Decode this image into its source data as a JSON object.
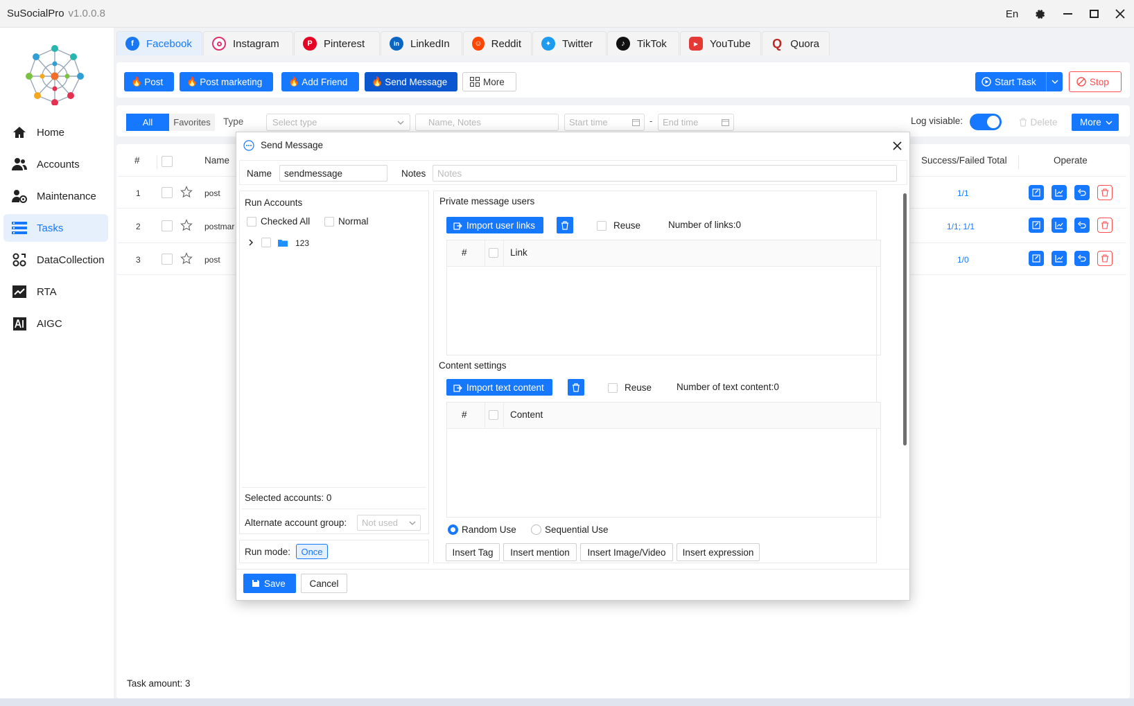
{
  "app": {
    "name": "SuSocialPro",
    "version": "v1.0.0.8",
    "lang": "En"
  },
  "sidebar": {
    "items": [
      {
        "label": "Home",
        "icon": "home-icon"
      },
      {
        "label": "Accounts",
        "icon": "users-icon"
      },
      {
        "label": "Maintenance",
        "icon": "user-gear-icon"
      },
      {
        "label": "Tasks",
        "icon": "tasks-icon",
        "active": true
      },
      {
        "label": "DataCollection",
        "icon": "data-collection-icon"
      },
      {
        "label": "RTA",
        "icon": "chart-line-icon"
      },
      {
        "label": "AIGC",
        "icon": "ai-icon"
      }
    ]
  },
  "tabs": [
    {
      "label": "Facebook",
      "color": "#1877f2"
    },
    {
      "label": "Instagram",
      "color": "#e1306c"
    },
    {
      "label": "Pinterest",
      "color": "#e60023"
    },
    {
      "label": "LinkedIn",
      "color": "#0a66c2"
    },
    {
      "label": "Reddit",
      "color": "#ff4500"
    },
    {
      "label": "Twitter",
      "color": "#1d9bf0"
    },
    {
      "label": "TikTok",
      "color": "#111111"
    },
    {
      "label": "YouTube",
      "color": "#e53935"
    },
    {
      "label": "Quora",
      "color": "#b92b27"
    }
  ],
  "actions": {
    "post": "Post",
    "post_marketing": "Post marketing",
    "add_friend": "Add Friend",
    "send_message": "Send Message",
    "more": "More",
    "start_task": "Start Task",
    "stop": "Stop"
  },
  "filter": {
    "all": "All",
    "favorites": "Favorites",
    "type_label": "Type",
    "type_placeholder": "Select type",
    "search_placeholder": "Name, Notes",
    "start_placeholder": "Start time",
    "dash": "-",
    "end_placeholder": "End time",
    "log_visible": "Log visiable:",
    "delete": "Delete",
    "more": "More"
  },
  "table": {
    "headers": {
      "index": "#",
      "name": "Name",
      "success": "Success/Failed Total",
      "operate": "Operate"
    },
    "rows": [
      {
        "index": "1",
        "name": "post",
        "success": "1/1"
      },
      {
        "index": "2",
        "name": "postmar",
        "success": "1/1; 1/1"
      },
      {
        "index": "3",
        "name": "post",
        "success": "1/0"
      }
    ],
    "task_amount": "Task amount: 3"
  },
  "modal": {
    "title": "Send Message",
    "name_label": "Name",
    "name_value": "sendmessage",
    "notes_label": "Notes",
    "notes_placeholder": "Notes",
    "run_accounts": "Run Accounts",
    "checked_all": "Checked All",
    "normal": "Normal",
    "tree_item": "123",
    "selected_accounts": "Selected accounts: 0",
    "alt_group_label": "Alternate account group:",
    "alt_group_value": "Not used",
    "run_mode_label": "Run mode:",
    "run_mode_value": "Once",
    "pm_title": "Private message users",
    "import_links": "Import user links",
    "reuse": "Reuse",
    "num_links": "Number of links:0",
    "link_header_idx": "#",
    "link_header": "Link",
    "content_title": "Content settings",
    "import_text": "Import text content",
    "num_text": "Number of text content:0",
    "content_header_idx": "#",
    "content_header": "Content",
    "random_use": "Random Use",
    "sequential_use": "Sequential Use",
    "insert_tag": "Insert Tag",
    "insert_mention": "Insert mention",
    "insert_image": "Insert Image/Video",
    "insert_expression": "Insert expression",
    "save": "Save",
    "cancel": "Cancel"
  }
}
